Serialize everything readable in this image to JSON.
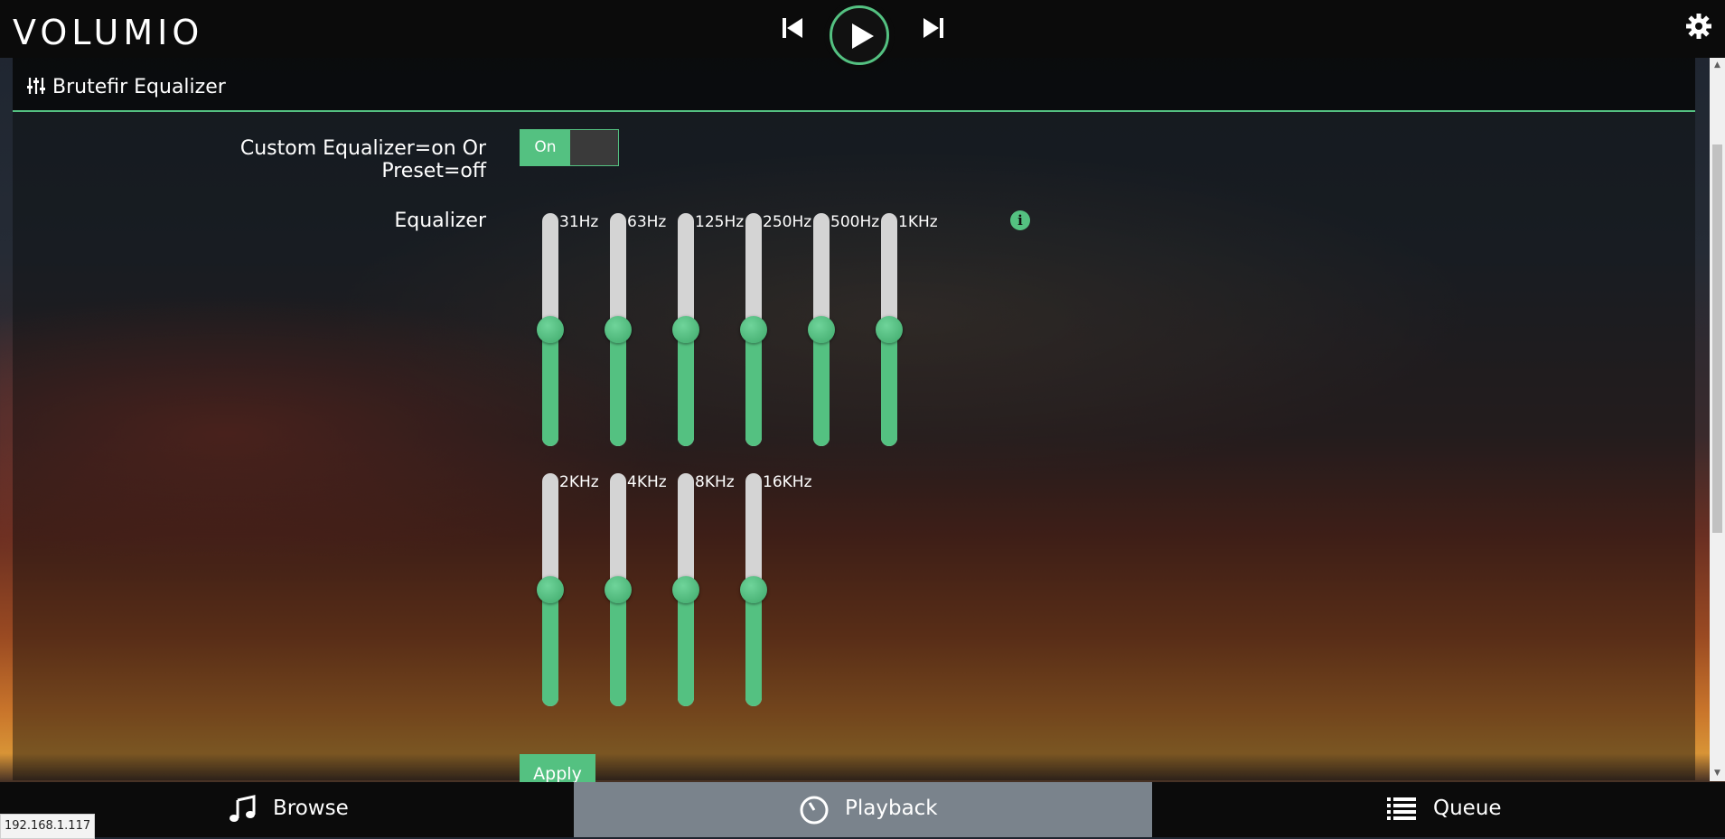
{
  "app": {
    "logo": "VOLUMIO"
  },
  "panel": {
    "title": "Brutefir Equalizer"
  },
  "toggle": {
    "label": "Custom Equalizer=on Or Preset=off",
    "state_label": "On",
    "on": true
  },
  "equalizer": {
    "label": "Equalizer",
    "bands": [
      {
        "label": "31Hz",
        "level": 0.5
      },
      {
        "label": "63Hz",
        "level": 0.5
      },
      {
        "label": "125Hz",
        "level": 0.5
      },
      {
        "label": "250Hz",
        "level": 0.5
      },
      {
        "label": "500Hz",
        "level": 0.5
      },
      {
        "label": "1KHz",
        "level": 0.5
      },
      {
        "label": "2KHz",
        "level": 0.5
      },
      {
        "label": "4KHz",
        "level": 0.5
      },
      {
        "label": "8KHz",
        "level": 0.5
      },
      {
        "label": "16KHz",
        "level": 0.5
      }
    ]
  },
  "actions": {
    "apply_label": "Apply"
  },
  "nav": {
    "browse": "Browse",
    "playback": "Playback",
    "queue": "Queue"
  },
  "status": {
    "url": "192.168.1.117"
  },
  "colors": {
    "accent": "#54c181",
    "active_tab": "#7a838c",
    "bar": "#0b0b0b"
  }
}
